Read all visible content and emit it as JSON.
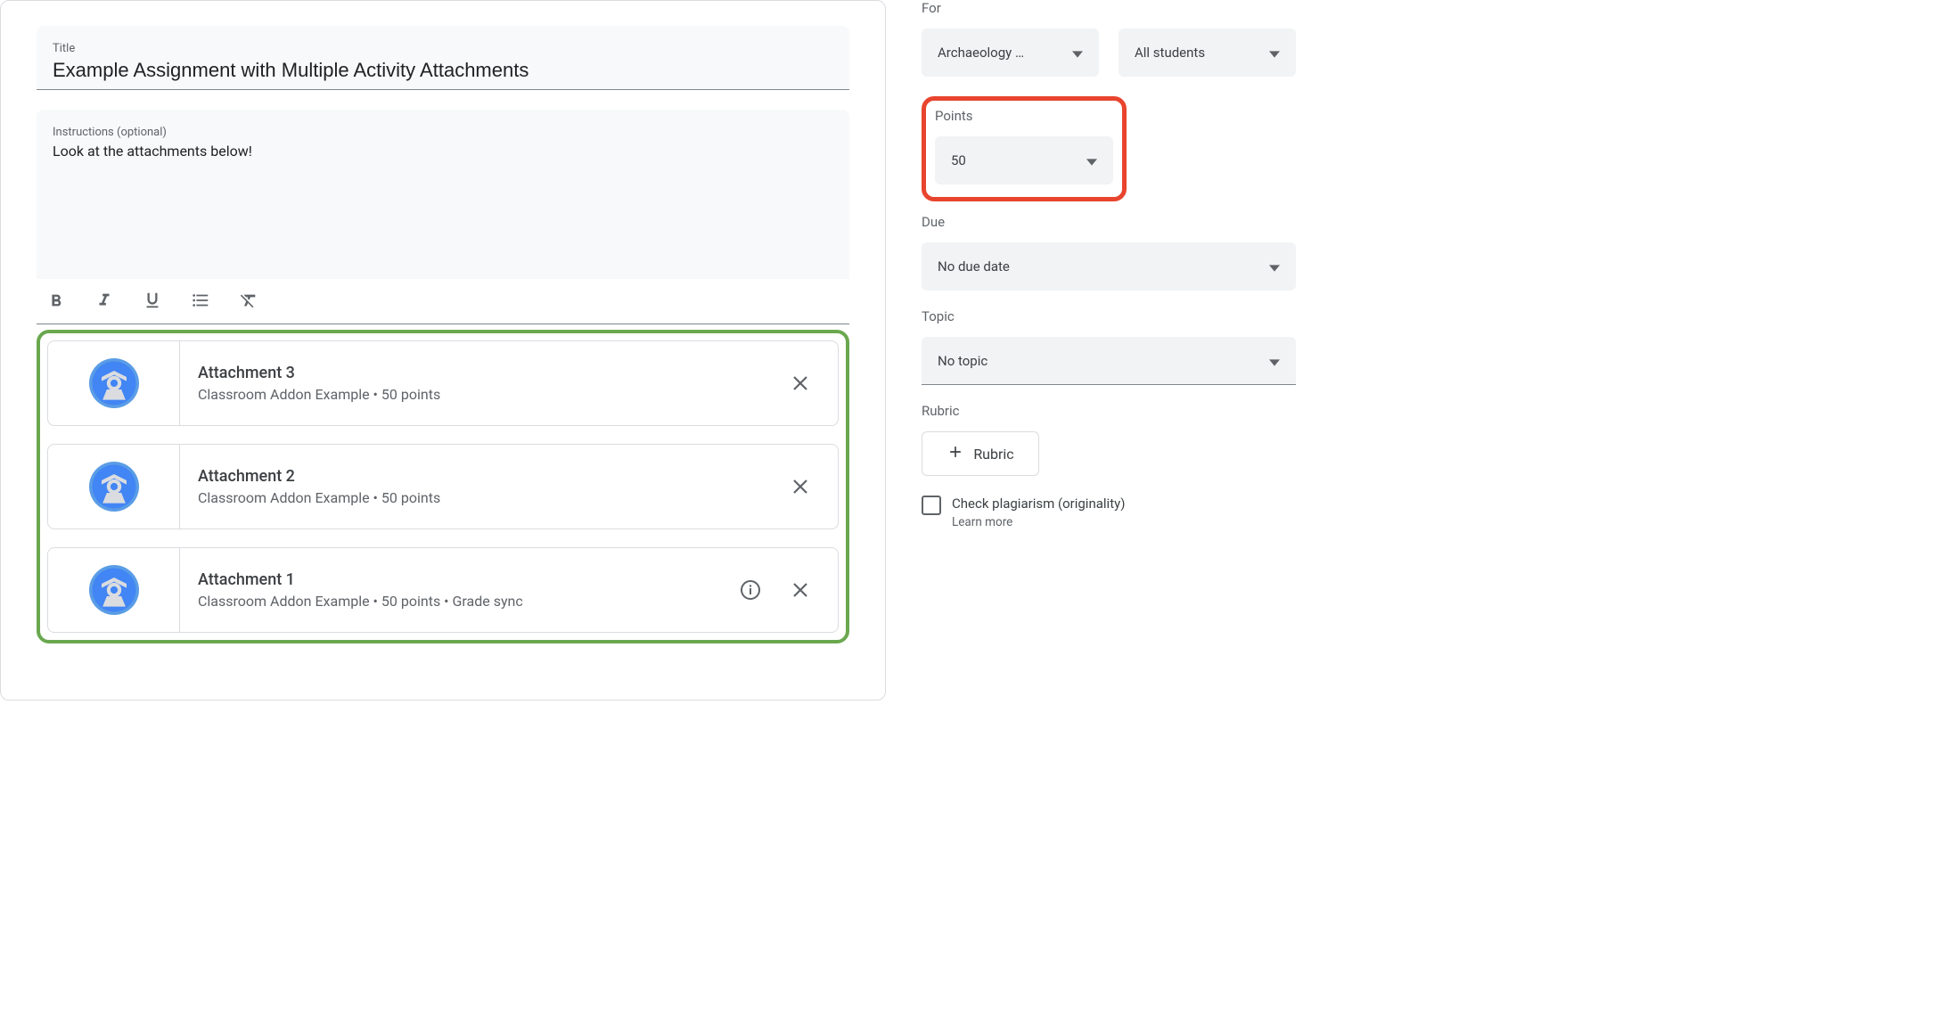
{
  "title_label": "Title",
  "title_value": "Example Assignment with Multiple Activity Attachments",
  "instructions_label": "Instructions (optional)",
  "instructions_value": "Look at the attachments below!",
  "attachments": [
    {
      "title": "Attachment 3",
      "subtitle": "Classroom Addon Example • 50 points",
      "has_info": false
    },
    {
      "title": "Attachment 2",
      "subtitle": "Classroom Addon Example • 50 points",
      "has_info": false
    },
    {
      "title": "Attachment 1",
      "subtitle": "Classroom Addon Example • 50 points • Grade sync",
      "has_info": true
    }
  ],
  "sidebar": {
    "for_label": "For",
    "class_value": "Archaeology …",
    "students_value": "All students",
    "points_label": "Points",
    "points_value": "50",
    "due_label": "Due",
    "due_value": "No due date",
    "topic_label": "Topic",
    "topic_value": "No topic",
    "rubric_label": "Rubric",
    "rubric_button": "Rubric",
    "plagiarism_label": "Check plagiarism (originality)",
    "learn_more": "Learn more"
  }
}
